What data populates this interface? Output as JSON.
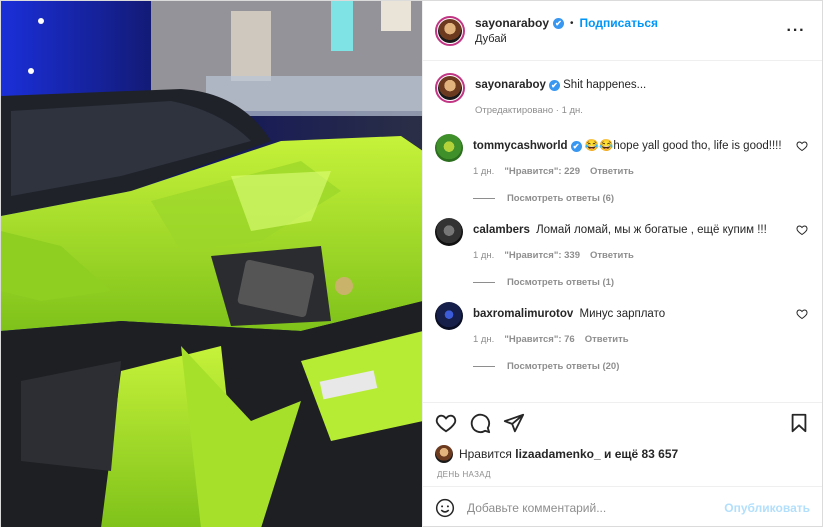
{
  "photo": {
    "alt": ""
  },
  "header": {
    "username": "sayonaraboy",
    "verified": "✔",
    "separator": "•",
    "follow_label": "Подписаться",
    "location": "Дубай",
    "more_icon": "ellipsis-icon"
  },
  "caption": {
    "username": "sayonaraboy",
    "verified": "✔",
    "text": "Shit happenes...",
    "edited": "Отредактировано · 1 дн."
  },
  "comments": [
    {
      "username": "tommycashworld",
      "verified": "✔",
      "text": "😂😂hope yall good tho, life is good!!!!",
      "time": "1 дн.",
      "likes": "\"Нравится\": 229",
      "reply": "Ответить",
      "view_replies": "Посмотреть ответы (6)"
    },
    {
      "username": "calambers",
      "text": "Ломай ломай, мы ж богатые , ещё купим !!!",
      "time": "1 дн.",
      "likes": "\"Нравится\": 339",
      "reply": "Ответить",
      "view_replies": "Посмотреть ответы (1)"
    },
    {
      "username": "baxromalimurotov",
      "text": "Минус зарплато",
      "time": "1 дн.",
      "likes": "\"Нравится\": 76",
      "reply": "Ответить",
      "view_replies": "Посмотреть ответы (20)"
    }
  ],
  "likes_line": {
    "prefix": "Нравится",
    "user": "lizaadamenko_",
    "suffix": "и ещё 83 657"
  },
  "timestamp": "День назад",
  "add_comment": {
    "placeholder": "Добавьте комментарий...",
    "publish_label": "Опубликовать"
  },
  "colors": {
    "accent": "#0095f6",
    "publish_disabled": "#b2dffc",
    "muted": "#8e8e8e",
    "verified": "#3897f0"
  }
}
